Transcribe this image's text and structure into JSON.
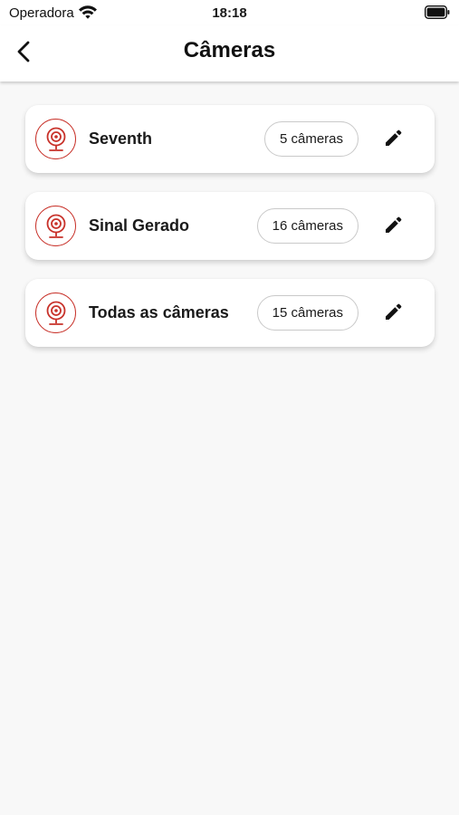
{
  "status_bar": {
    "carrier": "Operadora",
    "time": "18:18",
    "icons": [
      "wifi-icon",
      "battery-icon"
    ]
  },
  "header": {
    "title": "Câmeras",
    "back_icon": "chevron-left-icon"
  },
  "accent_color": "#c8322a",
  "groups": [
    {
      "name": "Seventh",
      "count": "5 câmeras",
      "icon": "webcam-icon",
      "action_icon": "pencil-icon"
    },
    {
      "name": "Sinal Gerado",
      "count": "16 câmeras",
      "icon": "webcam-icon",
      "action_icon": "pencil-icon"
    },
    {
      "name": "Todas as câmeras",
      "count": "15 câmeras",
      "icon": "webcam-icon",
      "action_icon": "pencil-icon"
    }
  ]
}
